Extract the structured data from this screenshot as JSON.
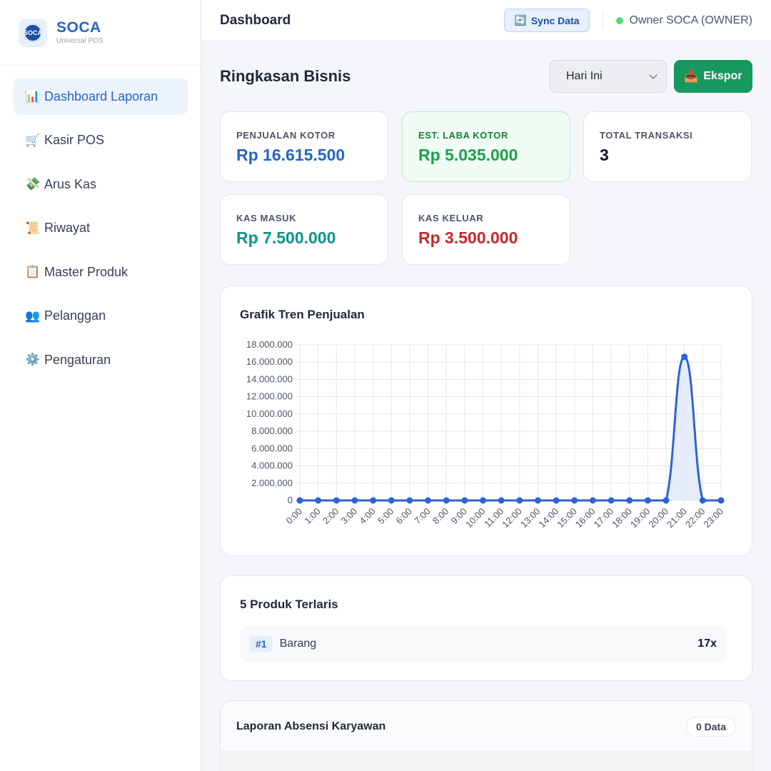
{
  "brand": {
    "name": "SOCA",
    "subtitle": "Universal POS",
    "logo_text": "SOCA"
  },
  "sidebar": {
    "items": [
      {
        "icon": "📊",
        "icon_name": "bar-chart-icon",
        "label": "Dashboard Laporan",
        "active": true
      },
      {
        "icon": "🛒",
        "icon_name": "cart-icon",
        "label": "Kasir POS"
      },
      {
        "icon": "💸",
        "icon_name": "money-wings-icon",
        "label": "Arus Kas"
      },
      {
        "icon": "📜",
        "icon_name": "scroll-icon",
        "label": "Riwayat"
      },
      {
        "icon": "📋",
        "icon_name": "clipboard-icon",
        "label": "Master Produk"
      },
      {
        "icon": "👥",
        "icon_name": "users-icon",
        "label": "Pelanggan"
      },
      {
        "icon": "⚙️",
        "icon_name": "gear-icon",
        "label": "Pengaturan"
      }
    ]
  },
  "header": {
    "title": "Dashboard",
    "sync_icon": "🔄",
    "sync_label": "Sync Data",
    "user": "Owner SOCA (OWNER)",
    "status_color": "#4ade80"
  },
  "summary": {
    "title": "Ringkasan Bisnis",
    "period_selected": "Hari Ini",
    "export_icon": "📥",
    "export_label": "Ekspor"
  },
  "stats": [
    {
      "label": "PENJUALAN KOTOR",
      "value": "Rp 16.615.500",
      "color": "#2563c9"
    },
    {
      "label": "EST. LABA KOTOR",
      "value": "Rp 5.035.000",
      "color": "#16a34a"
    },
    {
      "label": "TOTAL TRANSAKSI",
      "value": "3",
      "color": "#111827"
    },
    {
      "label": "KAS MASUK",
      "value": "Rp 7.500.000",
      "color": "#0f9488"
    },
    {
      "label": "KAS KELUAR",
      "value": "Rp 3.500.000",
      "color": "#c62828"
    }
  ],
  "chart_data": {
    "type": "area",
    "title": "Grafik Tren Penjualan",
    "xlabel": "",
    "ylabel": "",
    "categories": [
      "0:00",
      "1:00",
      "2:00",
      "3:00",
      "4:00",
      "5:00",
      "6:00",
      "7:00",
      "8:00",
      "9:00",
      "10:00",
      "11:00",
      "12:00",
      "13:00",
      "14:00",
      "15:00",
      "16:00",
      "17:00",
      "18:00",
      "19:00",
      "20:00",
      "21:00",
      "22:00",
      "23:00"
    ],
    "values": [
      0,
      0,
      0,
      0,
      0,
      0,
      0,
      0,
      0,
      0,
      0,
      0,
      0,
      0,
      0,
      0,
      0,
      0,
      0,
      0,
      0,
      16615500,
      0,
      0
    ],
    "ylim": [
      0,
      18000000
    ],
    "yticks": [
      0,
      2000000,
      4000000,
      6000000,
      8000000,
      10000000,
      12000000,
      14000000,
      16000000,
      18000000
    ],
    "ytick_labels": [
      "0",
      "2.000.000",
      "4.000.000",
      "6.000.000",
      "8.000.000",
      "10.000.000",
      "12.000.000",
      "14.000.000",
      "16.000.000",
      "18.000.000"
    ],
    "grid": true,
    "line_color": "#2f62d6",
    "fill_color": "#dfe8fa"
  },
  "top_products": {
    "title": "5 Produk Terlaris",
    "items": [
      {
        "rank": "#1",
        "name": "Barang",
        "qty": "17x"
      }
    ]
  },
  "attendance": {
    "title": "Laporan Absensi Karyawan",
    "count_label": "0 Data"
  }
}
